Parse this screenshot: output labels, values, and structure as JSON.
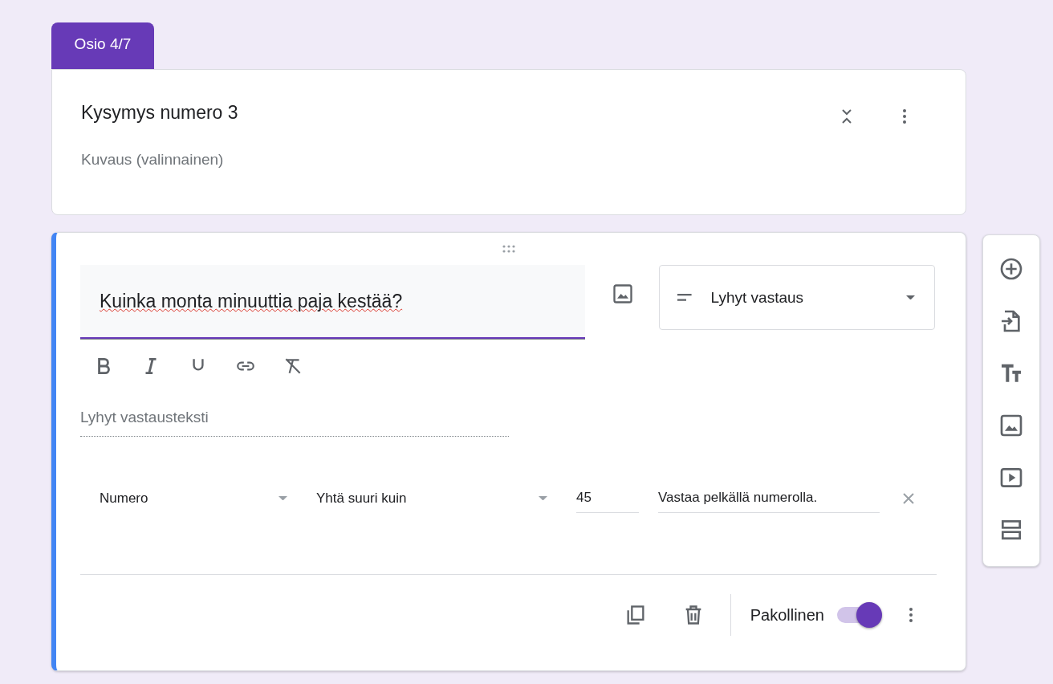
{
  "section_tab": {
    "label": "Osio 4/7"
  },
  "section_card": {
    "title": "Kysymys numero 3",
    "description_placeholder": "Kuvaus (valinnainen)"
  },
  "question": {
    "text": "Kuinka monta minuuttia paja kestää?",
    "type_dropdown": "Lyhyt vastaus",
    "answer_placeholder": "Lyhyt vastausteksti",
    "validation": {
      "category": "Numero",
      "condition": "Yhtä suuri kuin",
      "value": "45",
      "error_text": "Vastaa pelkällä numerolla."
    },
    "required_label": "Pakollinen",
    "required": true
  }
}
